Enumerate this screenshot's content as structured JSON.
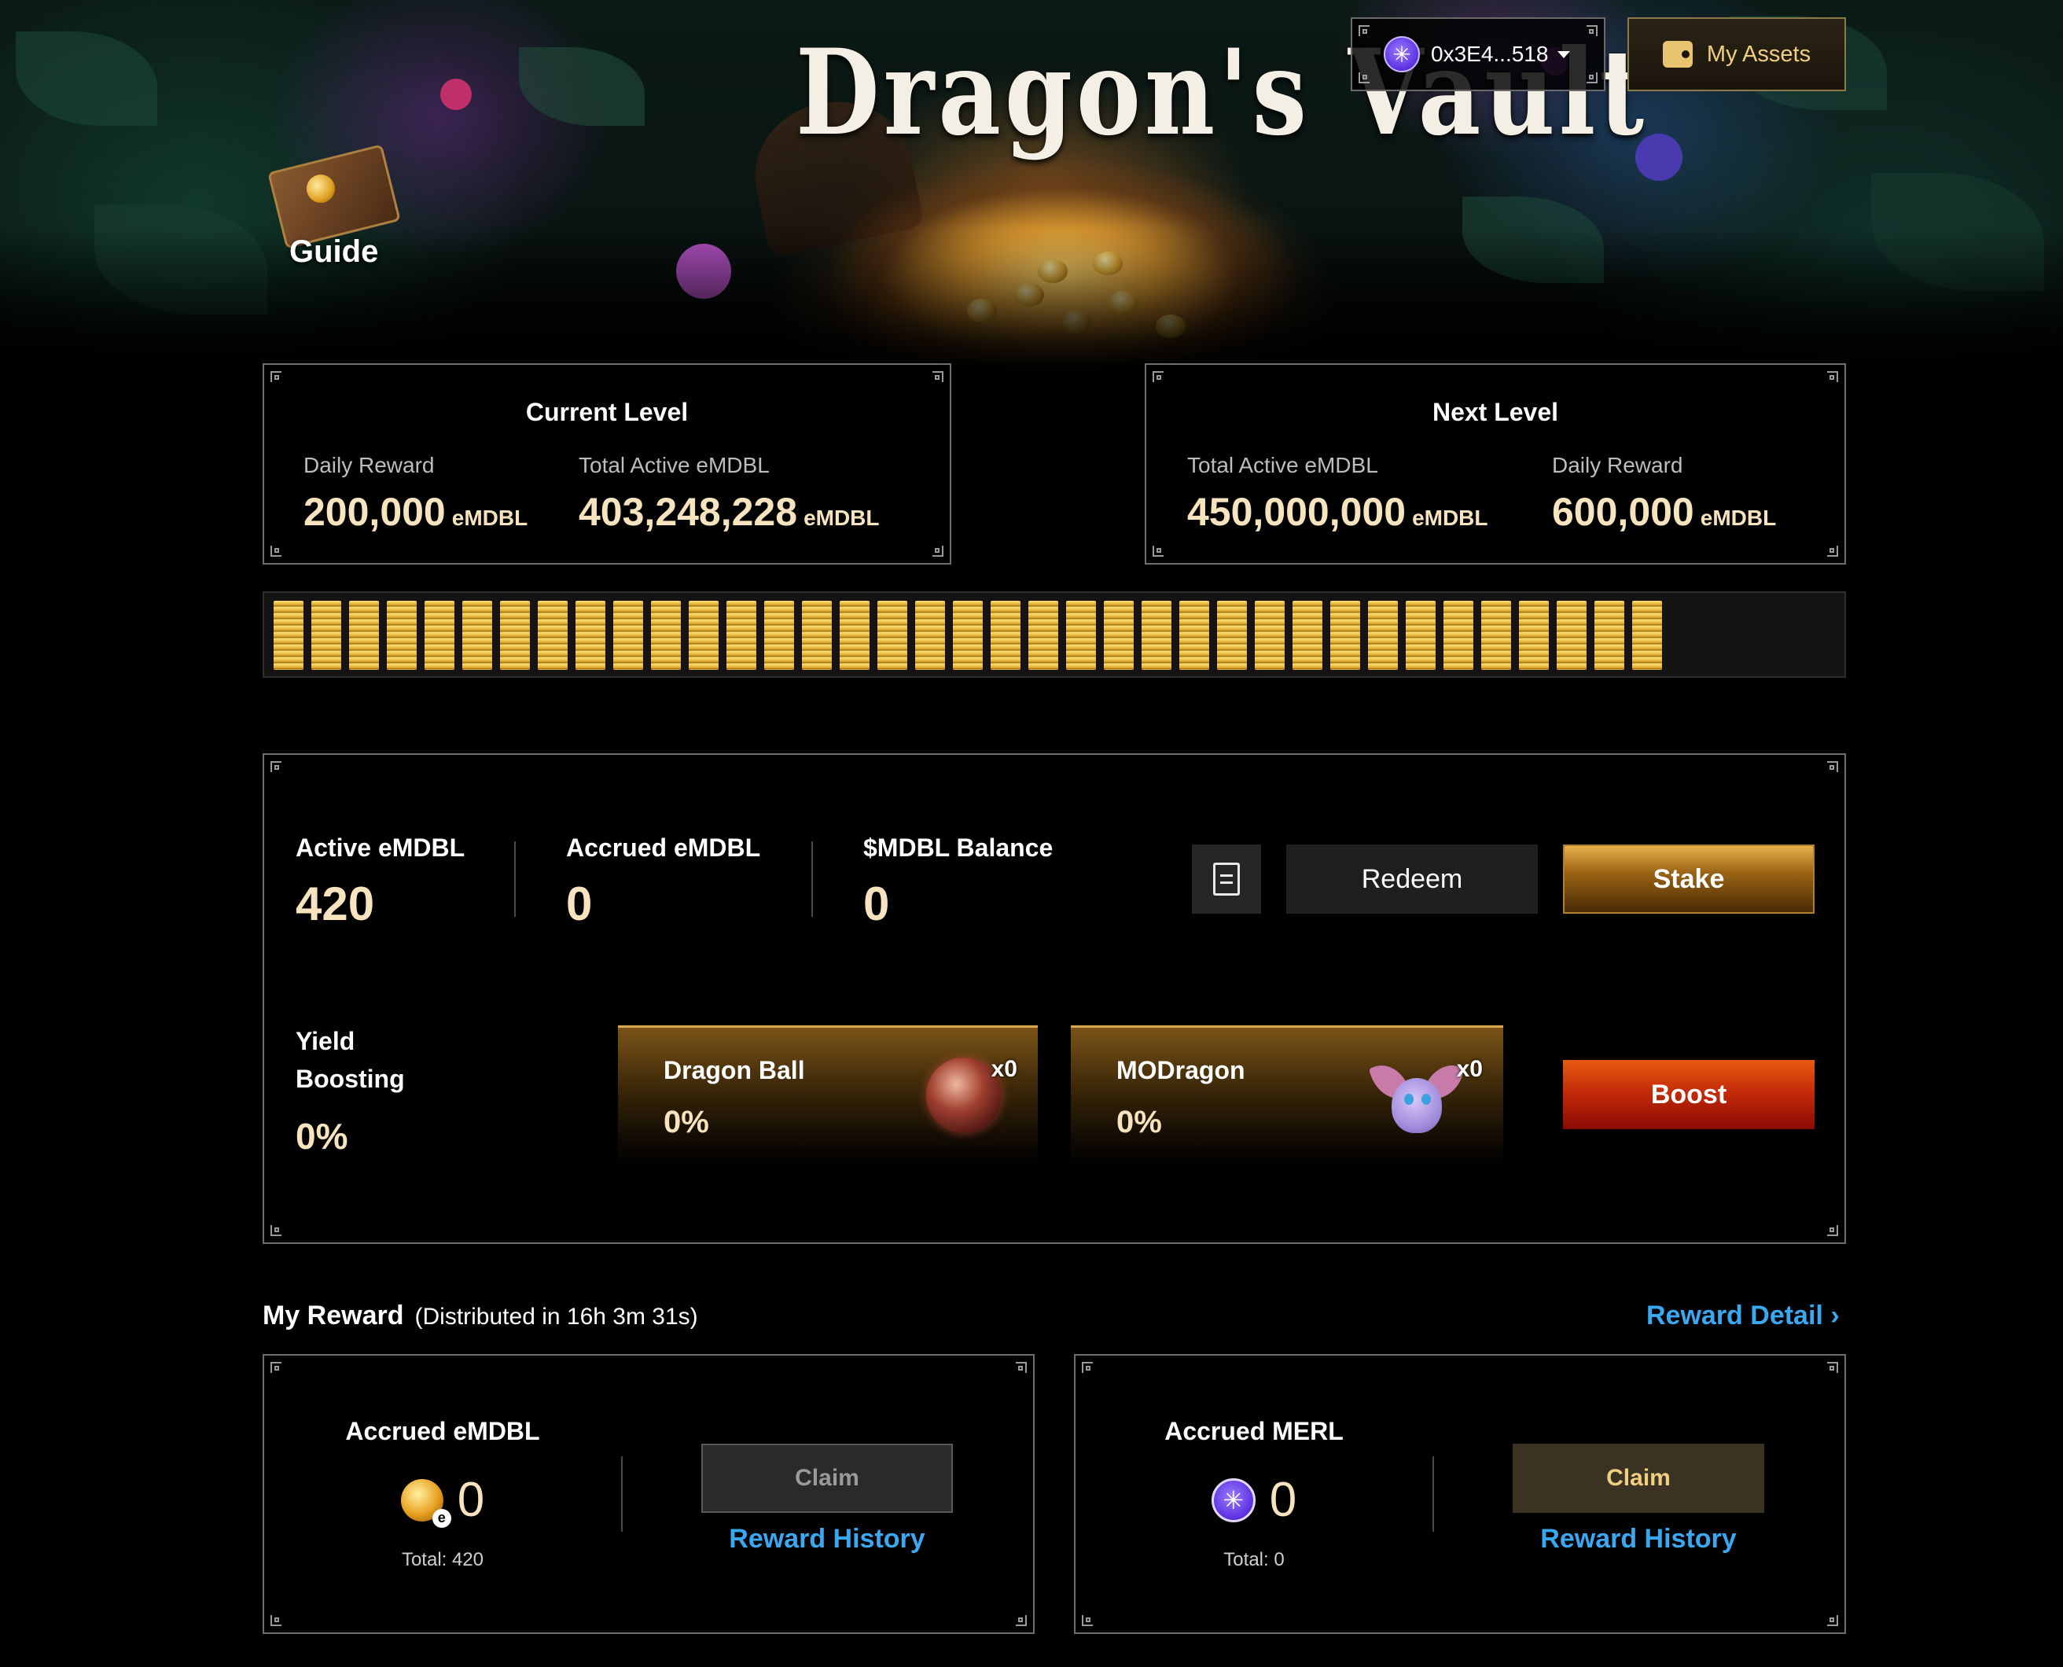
{
  "header": {
    "title": "Dragon's Vault",
    "guide_label": "Guide",
    "wallet": {
      "address": "0x3E4...518",
      "icon": "merl-token-icon"
    },
    "my_assets_label": "My Assets"
  },
  "levels": {
    "current": {
      "title": "Current Level",
      "daily_reward_label": "Daily Reward",
      "daily_reward_value": "200,000",
      "total_active_label": "Total Active eMDBL",
      "total_active_value": "403,248,228",
      "unit": "eMDBL"
    },
    "next": {
      "title": "Next Level",
      "total_active_label": "Total Active eMDBL",
      "total_active_value": "450,000,000",
      "daily_reward_label": "Daily Reward",
      "daily_reward_value": "600,000",
      "unit": "eMDBL"
    },
    "progress": {
      "filled_bars": 37,
      "fraction": 0.896
    }
  },
  "stats": {
    "active_label": "Active eMDBL",
    "active_value": "420",
    "accrued_label": "Accrued eMDBL",
    "accrued_value": "0",
    "balance_label": "$MDBL Balance",
    "balance_value": "0",
    "redeem_label": "Redeem",
    "stake_label": "Stake",
    "yield_label": "Yield Boosting",
    "yield_value": "0%",
    "boosts": [
      {
        "name": "Dragon Ball",
        "percent": "0%",
        "count": "x0"
      },
      {
        "name": "MODragon",
        "percent": "0%",
        "count": "x0"
      }
    ],
    "boost_label": "Boost"
  },
  "rewards": {
    "title": "My Reward",
    "distribution": "(Distributed in 16h 3m 31s)",
    "detail_link": "Reward Detail",
    "cards": [
      {
        "title": "Accrued eMDBL",
        "amount": "0",
        "badge": "e",
        "total": "Total: 420",
        "claim_label": "Claim",
        "history_label": "Reward History"
      },
      {
        "title": "Accrued MERL",
        "amount": "0",
        "total": "Total: 0",
        "claim_label": "Claim",
        "history_label": "Reward History"
      }
    ]
  },
  "colors": {
    "accent_gold": "#f7e3bd",
    "link_blue": "#3aa8f0",
    "stake_gold": "#9a6414",
    "boost_red": "#c02808"
  }
}
